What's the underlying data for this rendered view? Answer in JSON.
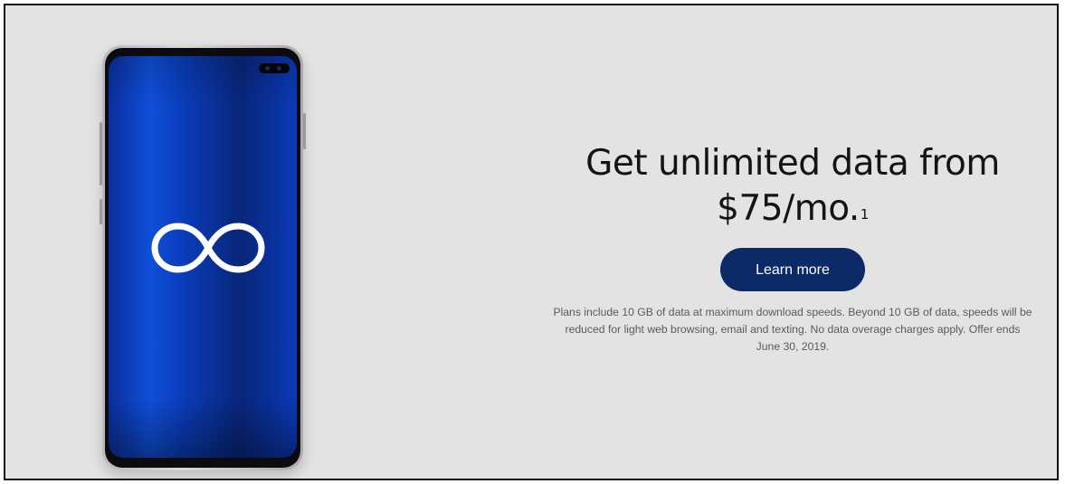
{
  "promo": {
    "headline_line1": "Get unlimited data from",
    "headline_price": "$75/mo.",
    "headline_footnote": "1",
    "cta_label": "Learn more",
    "disclaimer": "Plans include 10 GB of data at maximum download speeds. Beyond 10 GB of data, speeds will be reduced for light web browsing, email and texting. No data overage charges apply. Offer ends June 30, 2019."
  },
  "phone": {
    "screen_icon": "infinity-icon"
  },
  "colors": {
    "background": "#e3e3e3",
    "cta_background": "#0c2a66",
    "cta_text": "#ffffff",
    "screen_blue": "#0f4fd8",
    "headline_text": "#141414",
    "disclaimer_text": "#5a5a5a"
  }
}
